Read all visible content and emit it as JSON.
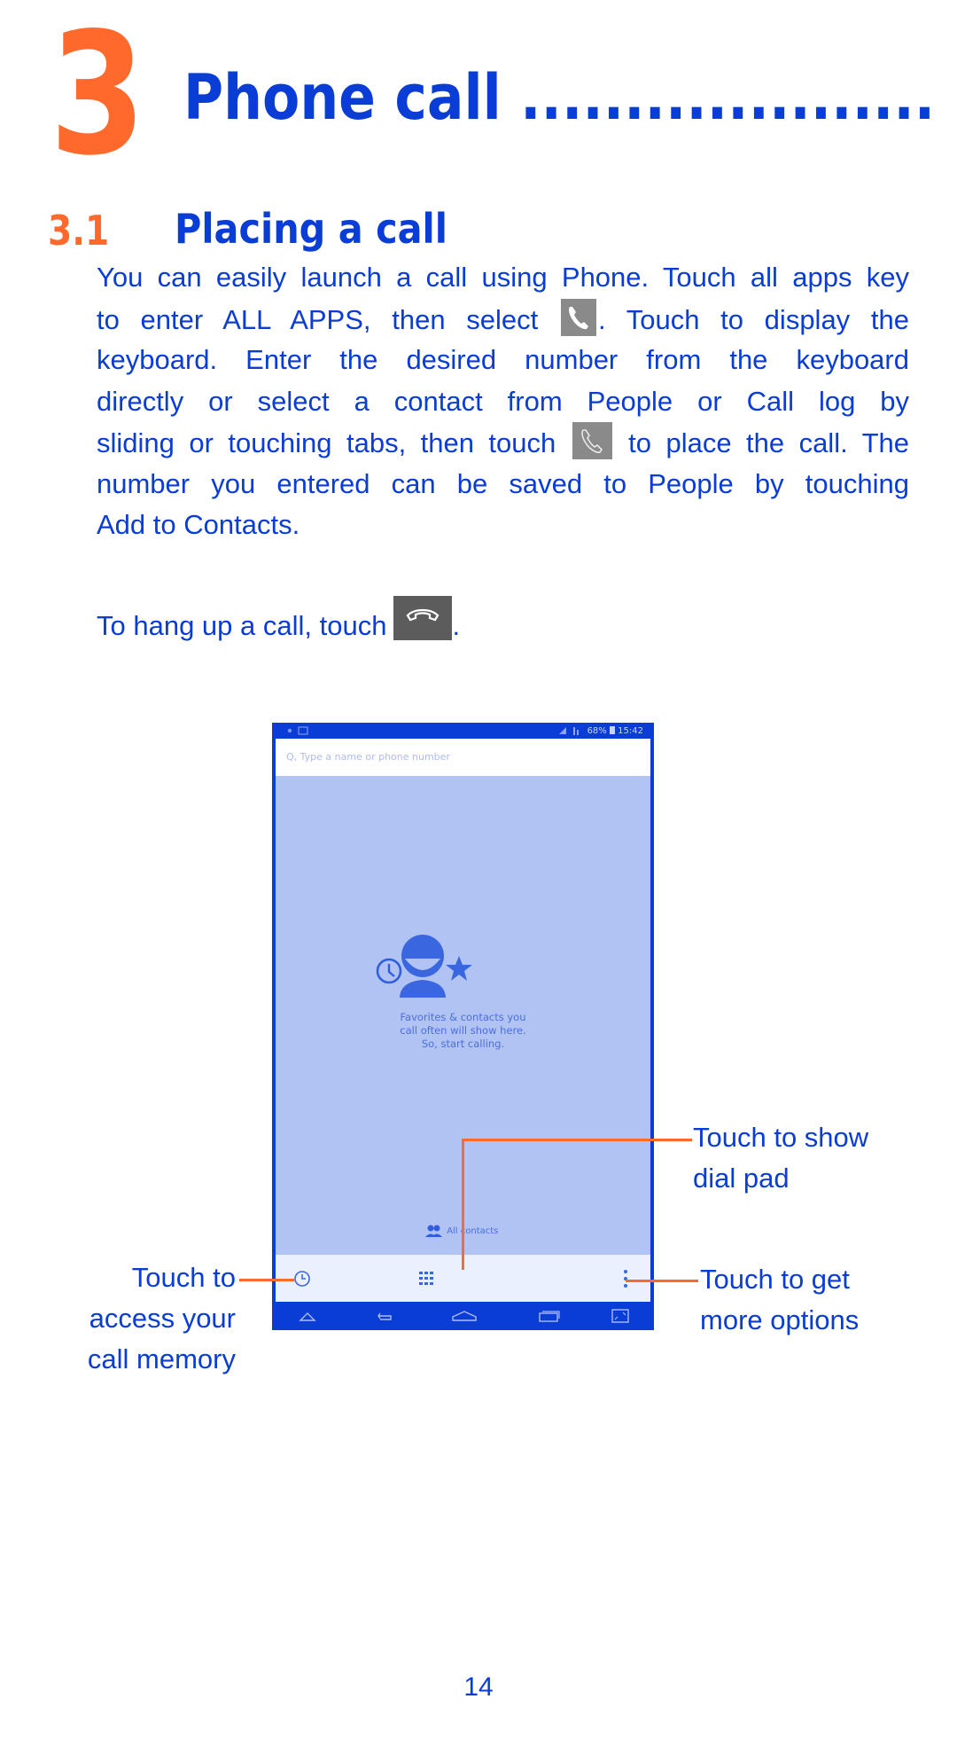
{
  "chapter": {
    "number": "3",
    "title": "Phone call ...................."
  },
  "section": {
    "number": "3.1",
    "title": "Placing a call"
  },
  "paragraph": {
    "lines": [
      [
        "You can easily launch a call using Phone. Touch all apps key"
      ],
      [
        "to enter ALL APPS, then select",
        "phone-app-icon",
        ". Touch to display the"
      ],
      [
        "keyboard. Enter the desired number from the keyboard"
      ],
      [
        "directly or select a contact from People or Call log by"
      ],
      [
        "sliding or touching tabs, then touch",
        "call-button-icon",
        "to place the call. The"
      ],
      [
        "number you entered can be saved to People by touching"
      ],
      [
        "Add to Contacts."
      ]
    ],
    "line1": "You can easily launch a call using Phone. Touch all apps key",
    "line2a": "to enter ALL APPS, then select",
    "line2b": ". Touch to display the",
    "line3": "keyboard. Enter the desired number from the keyboard",
    "line4": "directly or select a contact from People or Call log by",
    "line5a": "sliding or touching tabs, then touch",
    "line5b": "to place the call. The",
    "line6": "number you entered can be saved to People by touching",
    "line7": "Add to Contacts."
  },
  "hangup": {
    "text": "To hang up a call, touch",
    "suffix": "."
  },
  "phone_screen": {
    "status_bar": {
      "battery": "68%",
      "time": "15:42",
      "accent": "#0a3cd6"
    },
    "search_placeholder": "Q, Type a name or phone number",
    "empty_state": {
      "line1": "Favorites & contacts you",
      "line2": "call often will show here.",
      "line3": "So, start calling."
    },
    "all_contacts_label": "All contacts",
    "toolbar": [
      "call-history-icon",
      "dialpad-icon",
      "more-options-icon"
    ],
    "navbar": [
      "up-icon",
      "back-icon",
      "home-icon",
      "recents-icon",
      "screenshot-icon"
    ]
  },
  "callouts": {
    "call_memory": [
      "Touch to",
      "access your",
      "call memory"
    ],
    "dial_pad": [
      "Touch to show",
      "dial pad"
    ],
    "more_options": [
      "Touch to get",
      "more options"
    ]
  },
  "colors": {
    "brand_blue": "#0a3cd6",
    "accent_orange": "#ff6a2c",
    "screen_bg": "#b1c3f2"
  },
  "page_number": "14"
}
